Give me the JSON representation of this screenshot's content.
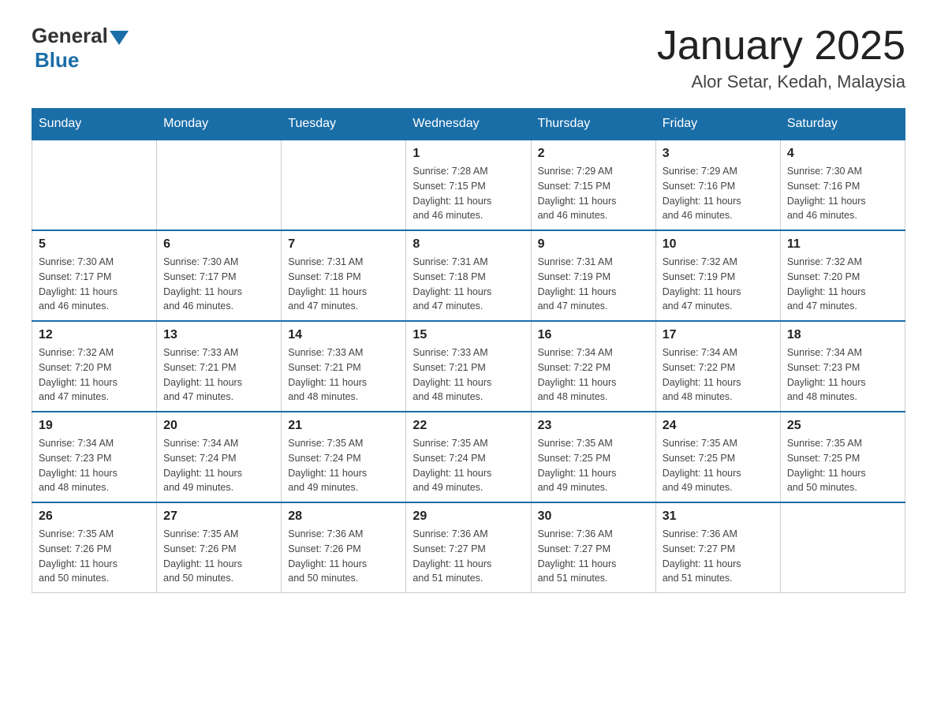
{
  "logo": {
    "general": "General",
    "blue": "Blue"
  },
  "header": {
    "month": "January 2025",
    "location": "Alor Setar, Kedah, Malaysia"
  },
  "weekdays": [
    "Sunday",
    "Monday",
    "Tuesday",
    "Wednesday",
    "Thursday",
    "Friday",
    "Saturday"
  ],
  "weeks": [
    [
      {
        "day": "",
        "info": ""
      },
      {
        "day": "",
        "info": ""
      },
      {
        "day": "",
        "info": ""
      },
      {
        "day": "1",
        "info": "Sunrise: 7:28 AM\nSunset: 7:15 PM\nDaylight: 11 hours\nand 46 minutes."
      },
      {
        "day": "2",
        "info": "Sunrise: 7:29 AM\nSunset: 7:15 PM\nDaylight: 11 hours\nand 46 minutes."
      },
      {
        "day": "3",
        "info": "Sunrise: 7:29 AM\nSunset: 7:16 PM\nDaylight: 11 hours\nand 46 minutes."
      },
      {
        "day": "4",
        "info": "Sunrise: 7:30 AM\nSunset: 7:16 PM\nDaylight: 11 hours\nand 46 minutes."
      }
    ],
    [
      {
        "day": "5",
        "info": "Sunrise: 7:30 AM\nSunset: 7:17 PM\nDaylight: 11 hours\nand 46 minutes."
      },
      {
        "day": "6",
        "info": "Sunrise: 7:30 AM\nSunset: 7:17 PM\nDaylight: 11 hours\nand 46 minutes."
      },
      {
        "day": "7",
        "info": "Sunrise: 7:31 AM\nSunset: 7:18 PM\nDaylight: 11 hours\nand 47 minutes."
      },
      {
        "day": "8",
        "info": "Sunrise: 7:31 AM\nSunset: 7:18 PM\nDaylight: 11 hours\nand 47 minutes."
      },
      {
        "day": "9",
        "info": "Sunrise: 7:31 AM\nSunset: 7:19 PM\nDaylight: 11 hours\nand 47 minutes."
      },
      {
        "day": "10",
        "info": "Sunrise: 7:32 AM\nSunset: 7:19 PM\nDaylight: 11 hours\nand 47 minutes."
      },
      {
        "day": "11",
        "info": "Sunrise: 7:32 AM\nSunset: 7:20 PM\nDaylight: 11 hours\nand 47 minutes."
      }
    ],
    [
      {
        "day": "12",
        "info": "Sunrise: 7:32 AM\nSunset: 7:20 PM\nDaylight: 11 hours\nand 47 minutes."
      },
      {
        "day": "13",
        "info": "Sunrise: 7:33 AM\nSunset: 7:21 PM\nDaylight: 11 hours\nand 47 minutes."
      },
      {
        "day": "14",
        "info": "Sunrise: 7:33 AM\nSunset: 7:21 PM\nDaylight: 11 hours\nand 48 minutes."
      },
      {
        "day": "15",
        "info": "Sunrise: 7:33 AM\nSunset: 7:21 PM\nDaylight: 11 hours\nand 48 minutes."
      },
      {
        "day": "16",
        "info": "Sunrise: 7:34 AM\nSunset: 7:22 PM\nDaylight: 11 hours\nand 48 minutes."
      },
      {
        "day": "17",
        "info": "Sunrise: 7:34 AM\nSunset: 7:22 PM\nDaylight: 11 hours\nand 48 minutes."
      },
      {
        "day": "18",
        "info": "Sunrise: 7:34 AM\nSunset: 7:23 PM\nDaylight: 11 hours\nand 48 minutes."
      }
    ],
    [
      {
        "day": "19",
        "info": "Sunrise: 7:34 AM\nSunset: 7:23 PM\nDaylight: 11 hours\nand 48 minutes."
      },
      {
        "day": "20",
        "info": "Sunrise: 7:34 AM\nSunset: 7:24 PM\nDaylight: 11 hours\nand 49 minutes."
      },
      {
        "day": "21",
        "info": "Sunrise: 7:35 AM\nSunset: 7:24 PM\nDaylight: 11 hours\nand 49 minutes."
      },
      {
        "day": "22",
        "info": "Sunrise: 7:35 AM\nSunset: 7:24 PM\nDaylight: 11 hours\nand 49 minutes."
      },
      {
        "day": "23",
        "info": "Sunrise: 7:35 AM\nSunset: 7:25 PM\nDaylight: 11 hours\nand 49 minutes."
      },
      {
        "day": "24",
        "info": "Sunrise: 7:35 AM\nSunset: 7:25 PM\nDaylight: 11 hours\nand 49 minutes."
      },
      {
        "day": "25",
        "info": "Sunrise: 7:35 AM\nSunset: 7:25 PM\nDaylight: 11 hours\nand 50 minutes."
      }
    ],
    [
      {
        "day": "26",
        "info": "Sunrise: 7:35 AM\nSunset: 7:26 PM\nDaylight: 11 hours\nand 50 minutes."
      },
      {
        "day": "27",
        "info": "Sunrise: 7:35 AM\nSunset: 7:26 PM\nDaylight: 11 hours\nand 50 minutes."
      },
      {
        "day": "28",
        "info": "Sunrise: 7:36 AM\nSunset: 7:26 PM\nDaylight: 11 hours\nand 50 minutes."
      },
      {
        "day": "29",
        "info": "Sunrise: 7:36 AM\nSunset: 7:27 PM\nDaylight: 11 hours\nand 51 minutes."
      },
      {
        "day": "30",
        "info": "Sunrise: 7:36 AM\nSunset: 7:27 PM\nDaylight: 11 hours\nand 51 minutes."
      },
      {
        "day": "31",
        "info": "Sunrise: 7:36 AM\nSunset: 7:27 PM\nDaylight: 11 hours\nand 51 minutes."
      },
      {
        "day": "",
        "info": ""
      }
    ]
  ]
}
